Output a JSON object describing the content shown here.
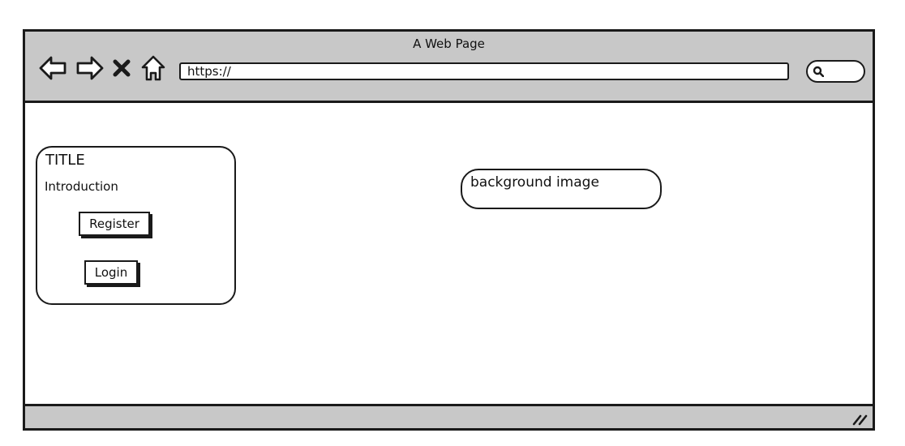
{
  "window": {
    "title": "A Web Page"
  },
  "toolbar": {
    "back_icon": "arrow-left-icon",
    "forward_icon": "arrow-right-icon",
    "stop_icon": "close-icon",
    "home_icon": "home-icon",
    "url_value": "https://",
    "search_icon": "search-icon"
  },
  "card": {
    "title": "TITLE",
    "introduction": "Introduction",
    "register_label": "Register",
    "login_label": "Login"
  },
  "hero": {
    "label": "background image"
  },
  "colors": {
    "chrome": "#c8c8c8",
    "stroke": "#1a1a1a",
    "background": "#ffffff"
  }
}
